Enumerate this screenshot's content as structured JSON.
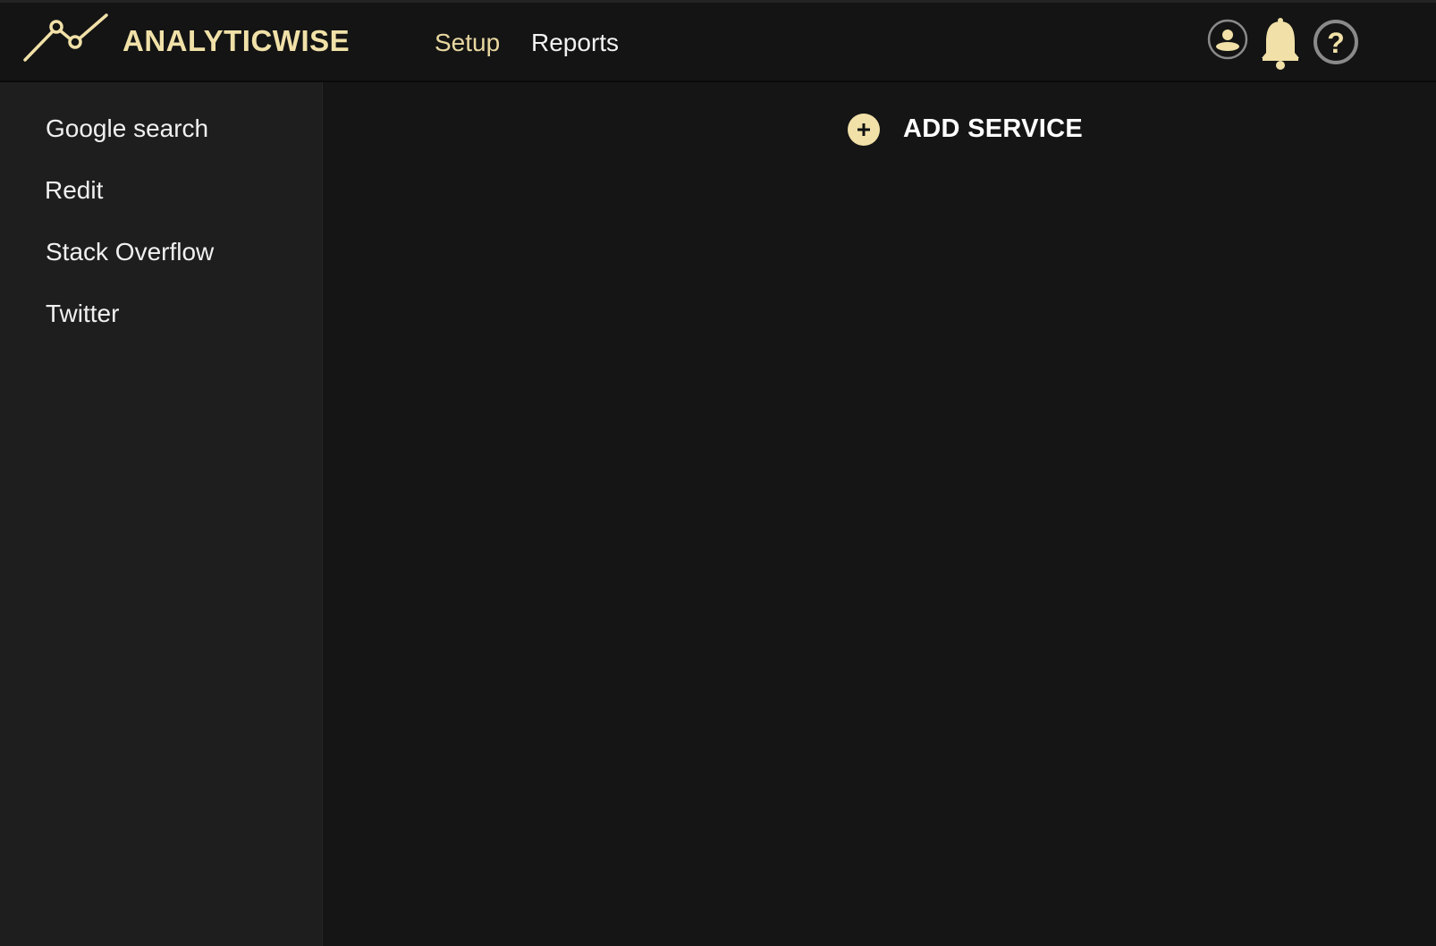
{
  "header": {
    "brand": "ANALYTICWISE",
    "logo_icon": "line-chart-logo-icon",
    "nav": [
      {
        "label": "Setup",
        "active": true
      },
      {
        "label": "Reports",
        "active": false
      }
    ],
    "icons": [
      "user-icon",
      "bell-icon",
      "help-icon"
    ]
  },
  "sidebar": {
    "items": [
      {
        "label": "Google search"
      },
      {
        "label": "Redit"
      },
      {
        "label": "Stack Overflow"
      },
      {
        "label": "Twitter"
      }
    ]
  },
  "main": {
    "add_service_label": "ADD SERVICE",
    "add_icon": "plus-circle-icon"
  },
  "colors": {
    "accent": "#f1e1a8",
    "background": "#151515",
    "sidebar": "#1f1e1f",
    "text": "#ffffff"
  }
}
